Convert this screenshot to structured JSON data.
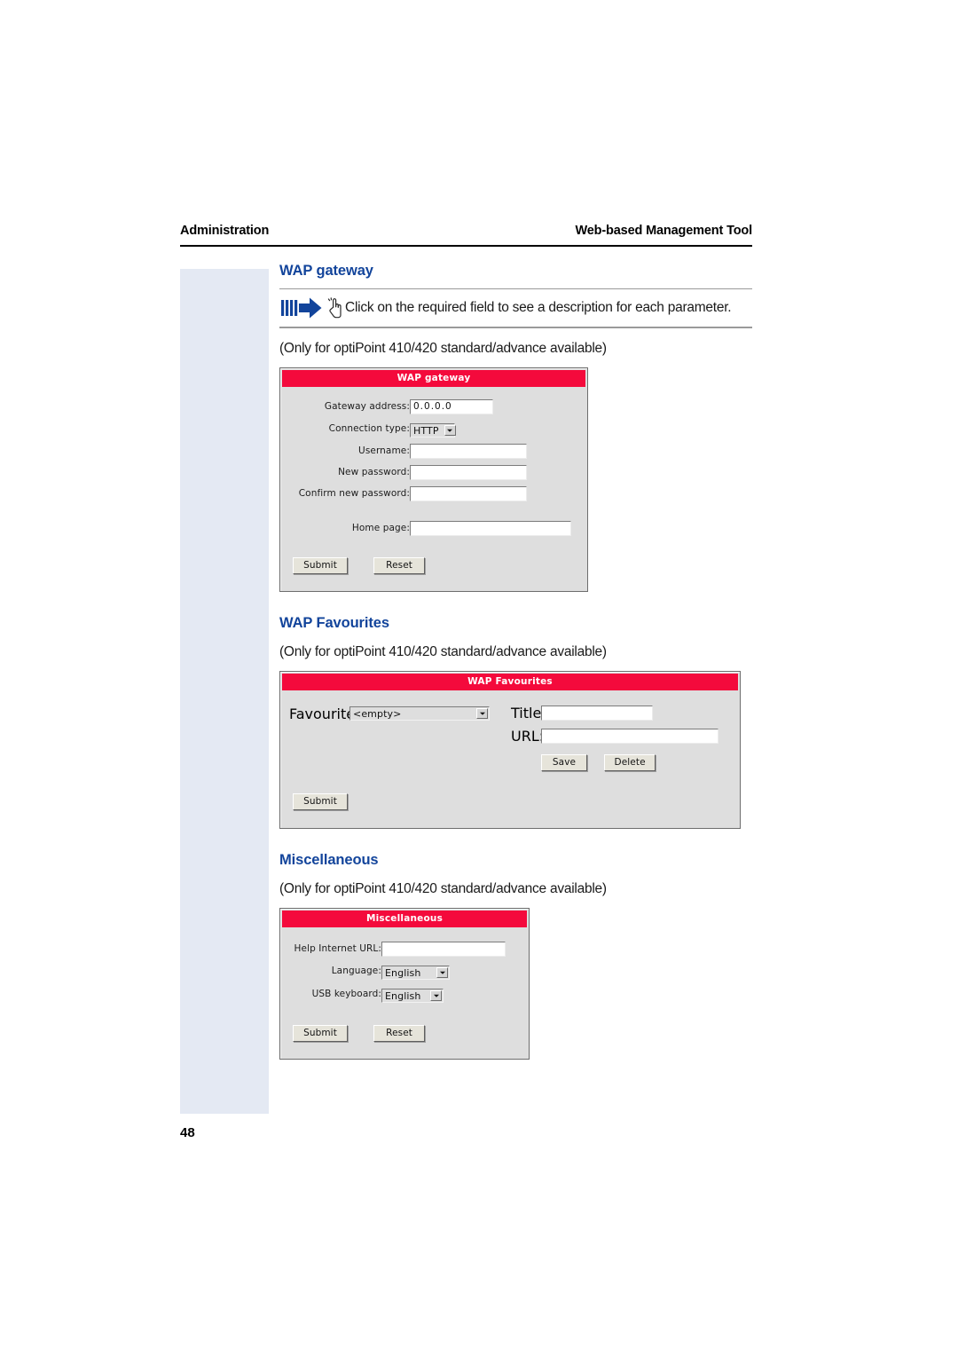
{
  "header": {
    "left": "Administration",
    "right": "Web-based Management Tool"
  },
  "folio": "48",
  "colors": {
    "heading_blue": "#12449b",
    "panel_red": "#f40a3c",
    "margin_band": "#e4e9f3",
    "arrow_blue": "#12449b",
    "widget_face": "#dedede"
  },
  "tip": {
    "icon_arrow": "right-arrow-icon",
    "icon_hand": "pointing-hand-icon",
    "text": "Click on the required field to see a description for each parameter."
  },
  "sections": [
    {
      "id": "wap-gateway",
      "heading": "WAP gateway",
      "note": "(Only for optiPoint 410/420 standard/advance available)",
      "panel_title": "WAP gateway",
      "fields": {
        "gateway_address": {
          "label": "Gateway address:",
          "value": "0.0.0.0"
        },
        "connection_type": {
          "label": "Connection type:",
          "value": "HTTP"
        },
        "username": {
          "label": "Username:",
          "value": ""
        },
        "new_password": {
          "label": "New password:",
          "value": ""
        },
        "confirm_new_password": {
          "label": "Confirm new password:",
          "value": ""
        },
        "home_page": {
          "label": "Home page:",
          "value": ""
        }
      },
      "buttons": {
        "submit": "Submit",
        "reset": "Reset"
      }
    },
    {
      "id": "wap-favourites",
      "heading": "WAP Favourites",
      "note": "(Only for optiPoint 410/420 standard/advance available)",
      "panel_title": "WAP Favourites",
      "fields": {
        "favourites": {
          "label": "Favourites:",
          "value": "<empty>"
        },
        "title": {
          "label": "Title:",
          "value": ""
        },
        "url": {
          "label": "URL:",
          "value": ""
        }
      },
      "buttons": {
        "save": "Save",
        "delete": "Delete",
        "submit": "Submit"
      }
    },
    {
      "id": "miscellaneous",
      "heading": "Miscellaneous",
      "note": "(Only for optiPoint 410/420 standard/advance available)",
      "panel_title": "Miscellaneous",
      "fields": {
        "help_internet_url": {
          "label": "Help Internet URL:",
          "value": ""
        },
        "language": {
          "label": "Language:",
          "value": "English"
        },
        "usb_keyboard": {
          "label": "USB keyboard:",
          "value": "English"
        }
      },
      "buttons": {
        "submit": "Submit",
        "reset": "Reset"
      }
    }
  ]
}
